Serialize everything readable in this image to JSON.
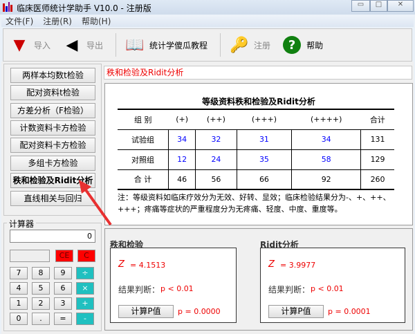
{
  "window": {
    "title": "临床医师统计学助手 V10.0 - 注册版",
    "minimize": "▭",
    "maximize": "□",
    "close": "✕"
  },
  "menu": [
    "文件(F)",
    "注册(R)",
    "帮助(H)"
  ],
  "toolbar": {
    "import": "导入",
    "export": "导出",
    "tutorial": "统计学傻瓜教程",
    "register": "注册",
    "help": "帮助"
  },
  "sidebar": {
    "items": [
      "两样本均数t检验",
      "配对资料t检验",
      "方差分析（F检验）",
      "计数资料卡方检验",
      "配对资料卡方检验",
      "多组卡方检验",
      "秩和检验及Ridit分析",
      "直线相关与回归"
    ],
    "active_index": 6
  },
  "calculator": {
    "title": "计算器",
    "display": "0",
    "ce": "CE",
    "c": "C",
    "keys": [
      [
        "7",
        "8",
        "9",
        "÷"
      ],
      [
        "4",
        "5",
        "6",
        "×"
      ],
      [
        "1",
        "2",
        "3",
        "+"
      ],
      [
        "0",
        ".",
        "=",
        "-"
      ]
    ]
  },
  "section_title": "秩和检验及Ridit分析",
  "table": {
    "title": "等级资料秩和检验及Ridit分析",
    "headers": [
      "组  别",
      "(+)",
      "(++)",
      "(+++)",
      "(++++)",
      "合计"
    ],
    "rows": [
      [
        "试验组",
        "34",
        "32",
        "31",
        "34",
        "131"
      ],
      [
        "对照组",
        "12",
        "24",
        "35",
        "58",
        "129"
      ],
      [
        "合  计",
        "46",
        "56",
        "66",
        "92",
        "260"
      ]
    ],
    "note": "注：等级资料如临床疗效分为无效、好转、显效；临床检验结果分为-、+、++、+++；疼痛等症状的严重程度分为无疼痛、轻度、中度、重度等。"
  },
  "rank_sum": {
    "title": "秩和检验",
    "z_label": "Z",
    "z": "=  4.1513",
    "judge_label": "结果判断：",
    "judge": "p < 0.01",
    "button": "计算P值",
    "p": "p = 0.0000"
  },
  "ridit": {
    "title": "Ridit分析",
    "z_label": "Z",
    "z": "=  3.9977",
    "judge_label": "结果判断：",
    "judge": "p < 0.01",
    "button": "计算P值",
    "p": "p = 0.0001"
  },
  "colors": {
    "accent_red": "#ee0000",
    "value_blue": "#0000ff",
    "operator_teal": "#20c0c0"
  }
}
